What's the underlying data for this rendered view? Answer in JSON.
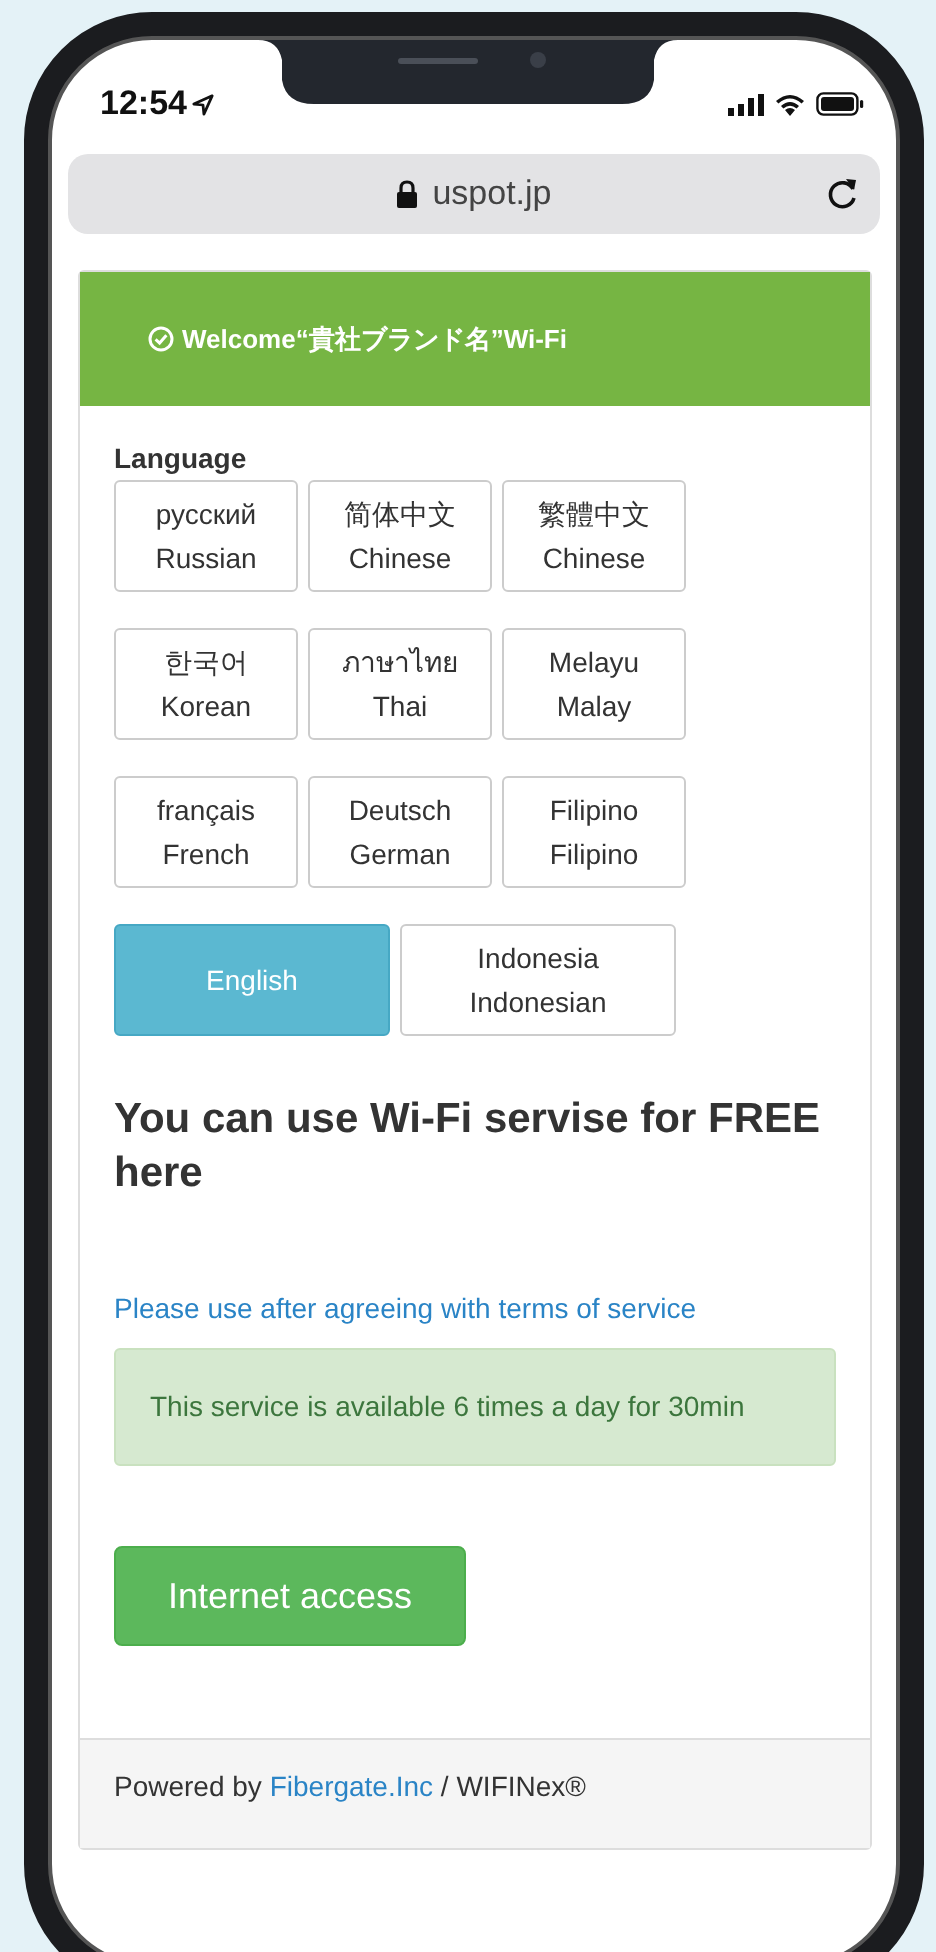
{
  "status_bar": {
    "time": "12:54"
  },
  "address_bar": {
    "url": "uspot.jp"
  },
  "card": {
    "title": "Welcome“貴社ブランド名”Wi-Fi",
    "language_label": "Language",
    "language_rows": [
      [
        {
          "lines": [
            "русский",
            "Russian"
          ],
          "selected": false
        },
        {
          "lines": [
            "简体中文",
            "Chinese"
          ],
          "selected": false
        },
        {
          "lines": [
            "繁體中文",
            "Chinese"
          ],
          "selected": false
        }
      ],
      [
        {
          "lines": [
            "한국어",
            "Korean"
          ],
          "selected": false
        },
        {
          "lines": [
            "ภาษาไทย",
            "Thai"
          ],
          "selected": false
        },
        {
          "lines": [
            "Melayu",
            "Malay"
          ],
          "selected": false
        }
      ],
      [
        {
          "lines": [
            "français",
            "French"
          ],
          "selected": false
        },
        {
          "lines": [
            "Deutsch",
            "German"
          ],
          "selected": false
        },
        {
          "lines": [
            "Filipino",
            "Filipino"
          ],
          "selected": false
        }
      ],
      [
        {
          "lines": [
            "English"
          ],
          "selected": true
        },
        {
          "lines": [
            "Indonesia",
            "Indonesian"
          ],
          "selected": false
        }
      ]
    ],
    "headline": "You can use Wi-Fi servise for FREE here",
    "terms_link": "Please use after agreeing with terms of service",
    "notice": "This service is available 6 times a day for 30min",
    "button": "Internet access",
    "footer": {
      "prefix": "Powered by",
      "link": "Fibergate.Inc",
      "suffix": "/ WIFINex®"
    }
  }
}
